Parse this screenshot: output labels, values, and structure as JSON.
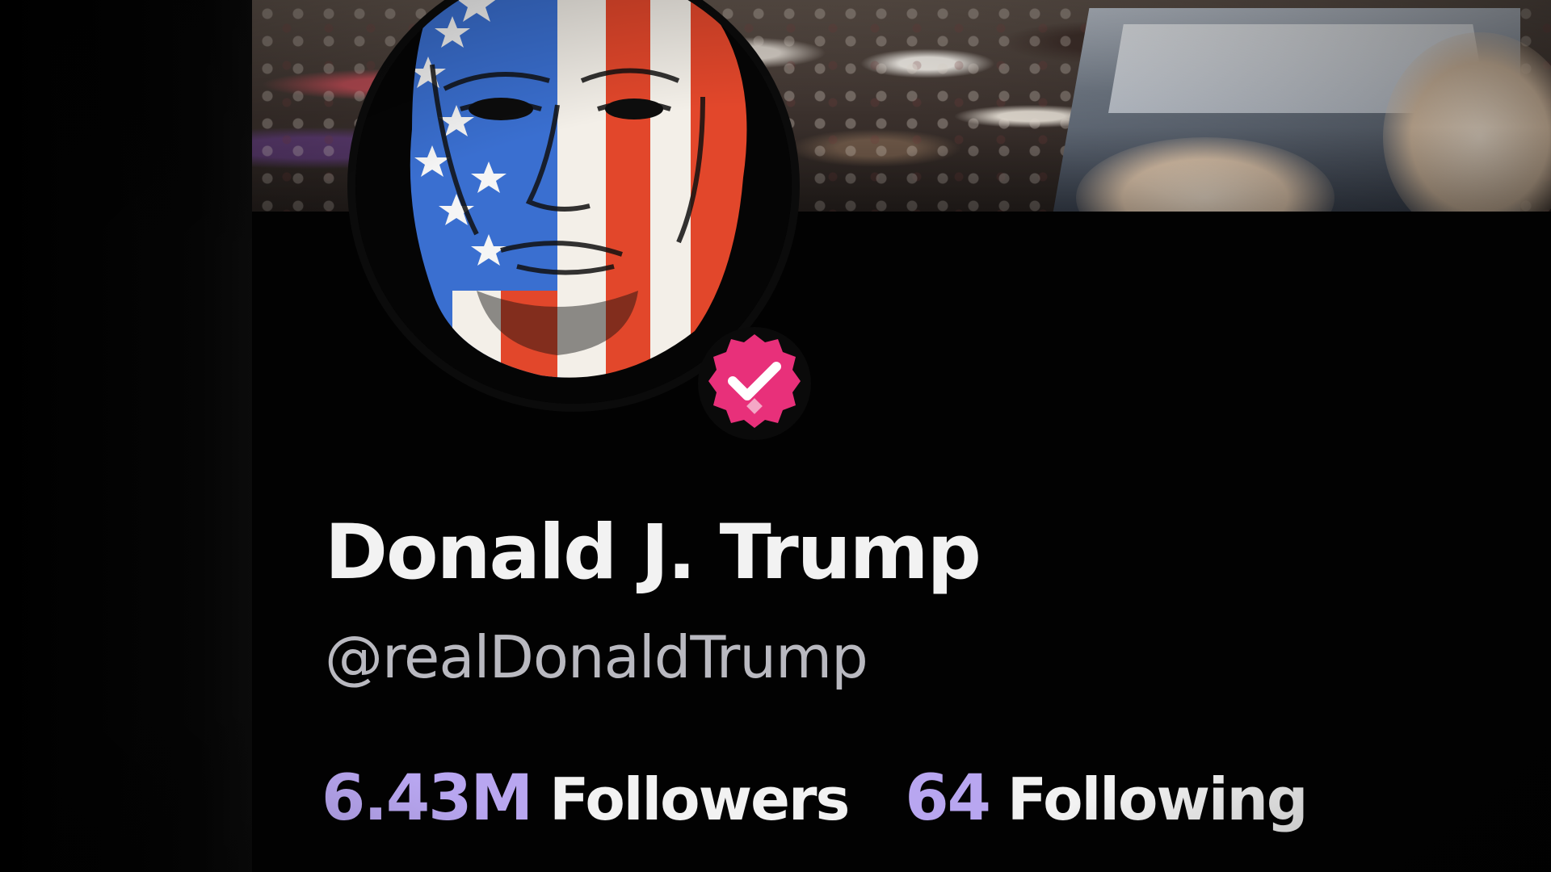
{
  "profile": {
    "display_name": "Donald J. Trump",
    "handle": "@realDonaldTrump",
    "verified": true,
    "avatar_description_icon": "avatar-flag-face",
    "banner_icon": "banner-rally-crowd"
  },
  "stats": {
    "followers": {
      "value": "6.43M",
      "label": "Followers"
    },
    "following": {
      "value": "64",
      "label": "Following"
    }
  },
  "colors": {
    "background": "#030303",
    "name_text": "#f2f2f2",
    "handle_text": "#b9b9c0",
    "stat_value": "#b8a6f0",
    "stat_label": "#f2f2f2",
    "verified_badge": "#e8307a"
  }
}
